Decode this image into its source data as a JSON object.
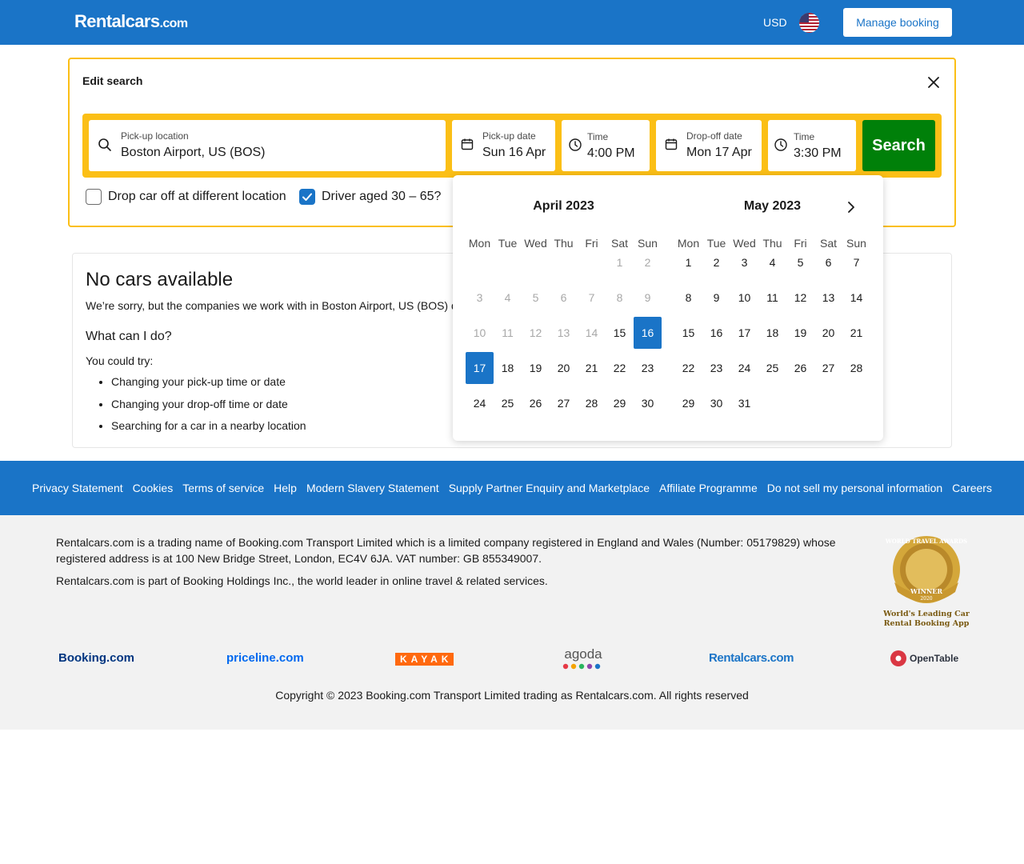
{
  "header": {
    "logo_main": "Rentalcars",
    "logo_suffix": ".com",
    "currency": "USD",
    "flag_icon": "us-flag-icon",
    "manage_booking": "Manage booking"
  },
  "edit_search": {
    "title": "Edit search",
    "pickup_location": {
      "label": "Pick-up location",
      "value": "Boston Airport, US (BOS)"
    },
    "pickup_date": {
      "label": "Pick-up date",
      "value": "Sun 16 Apr"
    },
    "pickup_time": {
      "label": "Time",
      "value": "4:00 PM"
    },
    "dropoff_date": {
      "label": "Drop-off date",
      "value": "Mon 17 Apr"
    },
    "dropoff_time": {
      "label": "Time",
      "value": "3:30 PM"
    },
    "search_button": "Search",
    "different_location": {
      "label": "Drop car off at different location",
      "checked": false
    },
    "driver_age": {
      "label": "Driver aged 30 – 65?",
      "checked": true
    }
  },
  "calendar": {
    "weekdays": [
      "Mon",
      "Tue",
      "Wed",
      "Thu",
      "Fri",
      "Sat",
      "Sun"
    ],
    "months": [
      {
        "title": "April 2023",
        "first_weekday": 5,
        "days": 30,
        "disabled_through": 14,
        "selected": [
          16,
          17
        ]
      },
      {
        "title": "May 2023",
        "first_weekday": 0,
        "days": 31,
        "disabled_through": 0,
        "selected": []
      }
    ]
  },
  "results": {
    "title": "No cars available",
    "message": "We’re sorry, but the companies we work with in Boston Airport, US (BOS) don’t have any cars available.",
    "subtitle": "What can I do?",
    "try_label": "You could try:",
    "suggestions": [
      "Changing your pick-up time or date",
      "Changing your drop-off time or date",
      "Searching for a car in a nearby location"
    ]
  },
  "footer": {
    "links": [
      "Privacy Statement",
      "Cookies",
      "Terms of service",
      "Help",
      "Modern Slavery Statement",
      "Supply Partner Enquiry and Marketplace",
      "Affiliate Programme",
      "Do not sell my personal information",
      "Careers"
    ],
    "legal_1": "Rentalcars.com is a trading name of Booking.com Transport Limited which is a limited company registered in England and Wales (Number: 05179829) whose registered address is at 100 New Bridge Street, London, EC4V 6JA. VAT number: GB 855349007.",
    "legal_2": "Rentalcars.com is part of Booking Holdings Inc., the world leader in online travel & related services.",
    "award": {
      "ring_text": "WORLD TRAVEL AWARDS",
      "ribbon": "WINNER",
      "year": "2020",
      "line1": "World's Leading Car",
      "line2": "Rental Booking App"
    },
    "brands": [
      {
        "name": "Booking.com",
        "color": "#003580"
      },
      {
        "name": "priceline.com",
        "color": "#0068ef"
      },
      {
        "name": "KAYAK",
        "color": "#ff690f"
      },
      {
        "name": "agoda",
        "color": "#555555"
      },
      {
        "name": "Rentalcars.com",
        "color": "#1a74c7"
      },
      {
        "name": "OpenTable",
        "color": "#da3743"
      }
    ],
    "copyright": "Copyright © 2023 Booking.com Transport Limited trading as Rentalcars.com. All rights reserved"
  }
}
